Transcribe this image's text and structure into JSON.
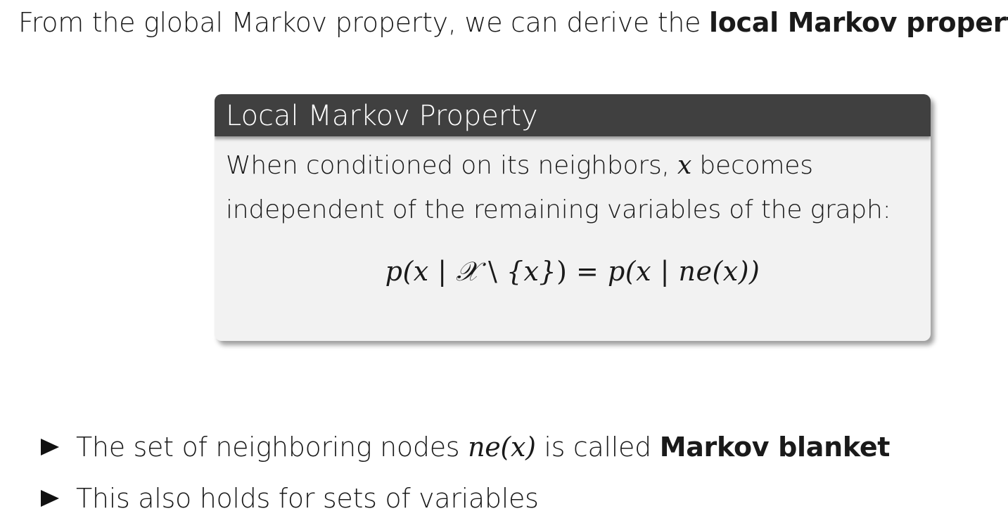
{
  "intro": {
    "text": "From the global Markov property, we can derive the ",
    "bold": "local Markov property:"
  },
  "block": {
    "title": "Local Markov Property",
    "line1_pre": "When conditioned on its neighbors, ",
    "line1_var": "x",
    "line1_post": " becomes",
    "line2": "independent of the remaining variables of the graph:",
    "equation": {
      "lhs_p": "p",
      "lhs_args": "(x | ",
      "set_symbol": "𝒳",
      "setminus": " \\ ",
      "set_x": "{x}",
      "close": ")",
      "equals": " = ",
      "rhs_p": "p",
      "rhs_args": "(x | ne(x))"
    }
  },
  "bullets": [
    {
      "pre": "The set of neighboring nodes ",
      "math": "ne(x)",
      "mid": " is called ",
      "bold": "Markov blanket"
    },
    {
      "text": "This also holds for sets of variables"
    }
  ]
}
